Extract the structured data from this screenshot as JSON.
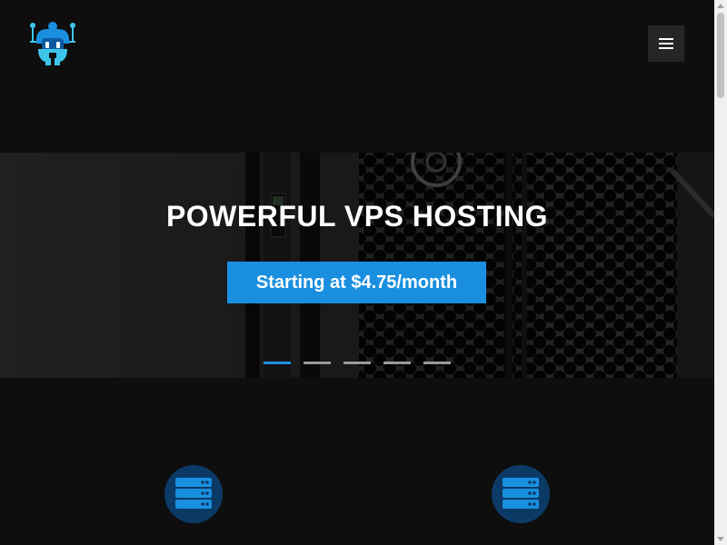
{
  "header": {
    "logo_icon": "robot-logo-icon",
    "menu_icon": "hamburger-menu-icon"
  },
  "hero": {
    "title": "POWERFUL VPS HOSTING",
    "cta_label": "Starting at $4.75/month",
    "slides": [
      {
        "active": true
      },
      {
        "active": false
      },
      {
        "active": false
      },
      {
        "active": false
      },
      {
        "active": false
      }
    ]
  },
  "features": {
    "items": [
      {
        "icon": "server-icon"
      },
      {
        "icon": "server-icon"
      }
    ]
  },
  "colors": {
    "accent": "#1a8fe0",
    "background": "#0e0e0e",
    "icon_circle": "#0c3a66",
    "logo_cyan": "#3ec6ea"
  }
}
